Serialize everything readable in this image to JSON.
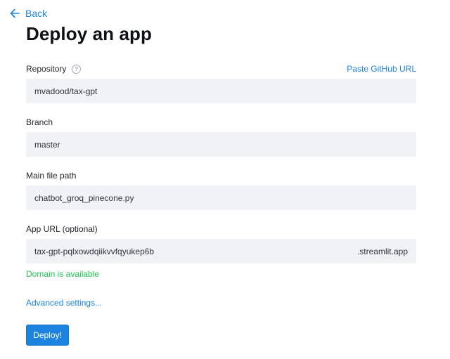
{
  "nav": {
    "back_label": "Back"
  },
  "page": {
    "title": "Deploy an app"
  },
  "repository": {
    "label": "Repository",
    "paste_link": "Paste GitHub URL",
    "value": "mvadood/tax-gpt"
  },
  "branch": {
    "label": "Branch",
    "value": "master"
  },
  "main_file": {
    "label": "Main file path",
    "value": "chatbot_groq_pinecone.py"
  },
  "app_url": {
    "label": "App URL (optional)",
    "value": "tax-gpt-pqlxowdqiikvvfqyukep6b",
    "suffix": ".streamlit.app",
    "status": "Domain is available"
  },
  "advanced_settings_label": "Advanced settings...",
  "deploy_button_label": "Deploy!",
  "colors": {
    "accent": "#1c83e1",
    "success": "#21c354",
    "input_bg": "#f0f2f6"
  },
  "icons": {
    "back": "arrow-left-icon",
    "help": "question-circle-icon"
  }
}
